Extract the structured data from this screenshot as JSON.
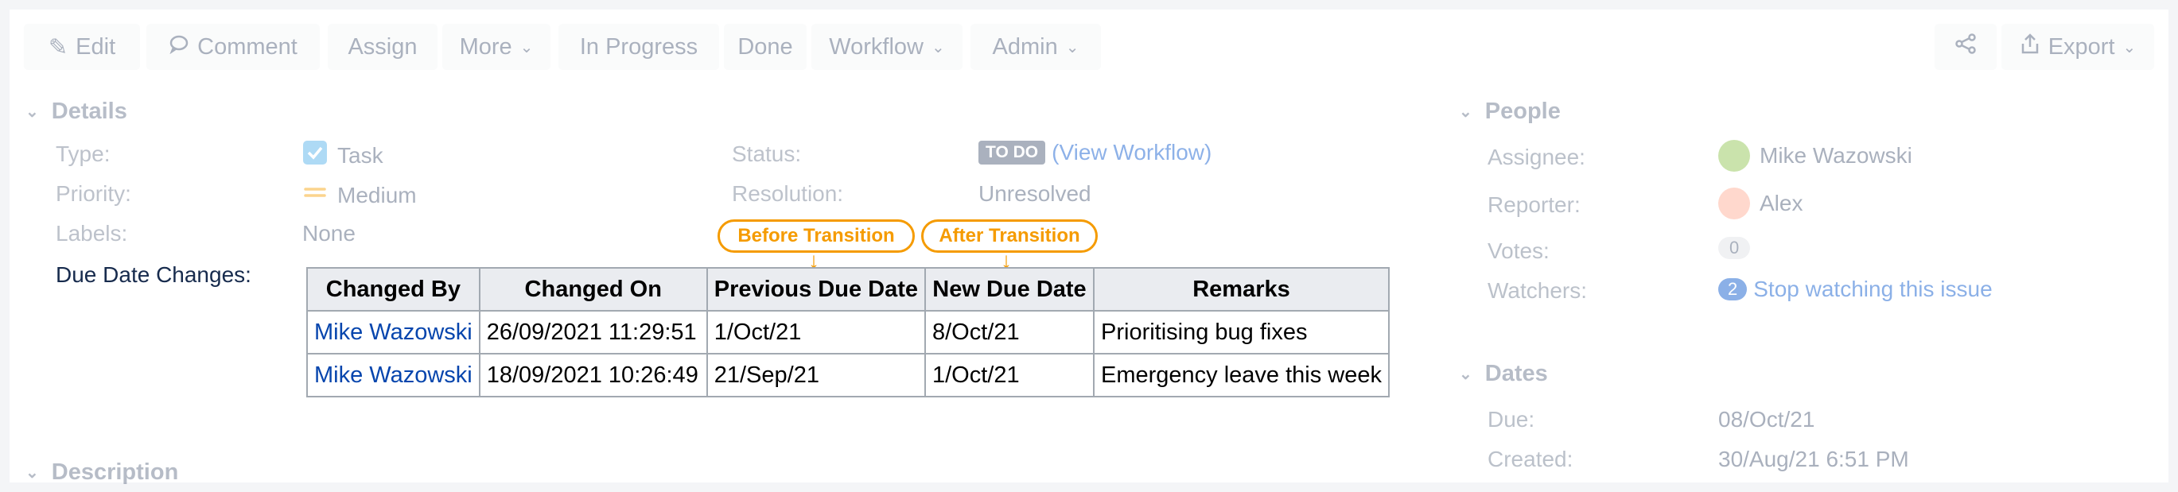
{
  "toolbar": {
    "edit": "Edit",
    "comment": "Comment",
    "assign": "Assign",
    "more": "More",
    "in_progress": "In Progress",
    "done": "Done",
    "workflow": "Workflow",
    "admin": "Admin",
    "export": "Export"
  },
  "details": {
    "title": "Details",
    "type_label": "Type:",
    "type_value": "Task",
    "priority_label": "Priority:",
    "priority_value": "Medium",
    "labels_label": "Labels:",
    "labels_value": "None",
    "status_label": "Status:",
    "status_badge": "TO DO",
    "status_link": "(View Workflow)",
    "resolution_label": "Resolution:",
    "resolution_value": "Unresolved",
    "due_changes_label": "Due Date Changes:"
  },
  "callouts": {
    "before": "Before Transition",
    "after": "After Transition"
  },
  "due_table": {
    "headers": [
      "Changed By",
      "Changed On",
      "Previous Due Date",
      "New Due Date",
      "Remarks"
    ],
    "rows": [
      [
        "Mike Wazowski",
        "26/09/2021 11:29:51",
        "1/Oct/21",
        "8/Oct/21",
        "Prioritising bug fixes"
      ],
      [
        "Mike Wazowski",
        "18/09/2021 10:26:49",
        "21/Sep/21",
        "1/Oct/21",
        "Emergency leave this week"
      ]
    ]
  },
  "people": {
    "title": "People",
    "assignee_label": "Assignee:",
    "assignee_value": "Mike Wazowski",
    "reporter_label": "Reporter:",
    "reporter_value": "Alex",
    "votes_label": "Votes:",
    "votes_value": "0",
    "watchers_label": "Watchers:",
    "watchers_count": "2",
    "watchers_link": "Stop watching this issue"
  },
  "dates": {
    "title": "Dates",
    "due_label": "Due:",
    "due_value": "08/Oct/21",
    "created_label": "Created:",
    "created_value": "30/Aug/21 6:51 PM"
  },
  "description": {
    "title": "Description"
  },
  "colors": {
    "accent": "#0052cc",
    "callout": "#f59b00",
    "wiki_link": "#0645ad"
  }
}
